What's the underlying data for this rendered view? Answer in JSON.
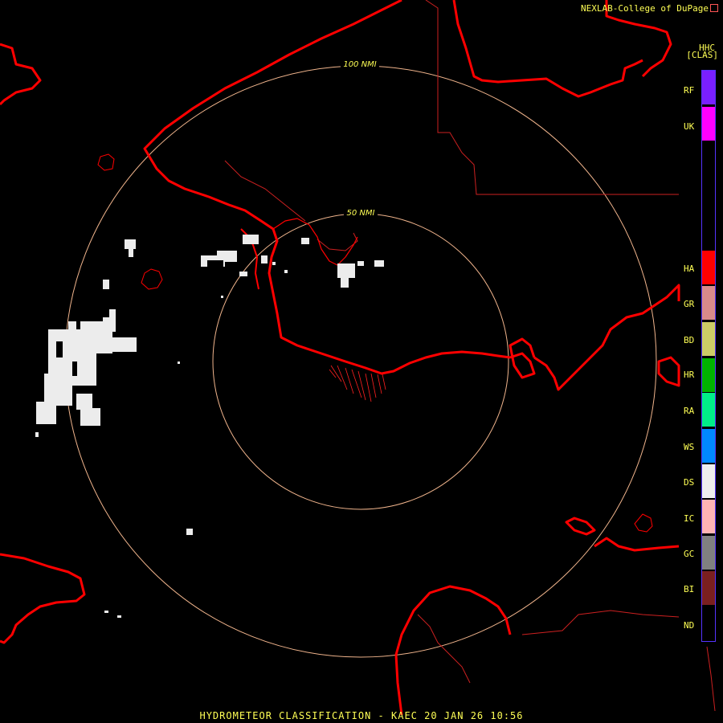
{
  "header": {
    "credit": "NEXLAB-College of DuPage",
    "product_code": "HHC",
    "scan_mode": "[CLAS]"
  },
  "rings": [
    {
      "label": "100 NMI"
    },
    {
      "label": "50 NMI"
    }
  ],
  "legend": [
    {
      "code": "RF",
      "color": "#7a1fff"
    },
    {
      "code": "UK",
      "color": "#ff00ff"
    },
    {
      "code": "HA",
      "color": "#ff0000"
    },
    {
      "code": "GR",
      "color": "#d98a8a"
    },
    {
      "code": "BD",
      "color": "#cccc66"
    },
    {
      "code": "HR",
      "color": "#00b400"
    },
    {
      "code": "RA",
      "color": "#00ee88"
    },
    {
      "code": "WS",
      "color": "#0088ff"
    },
    {
      "code": "DS",
      "color": "#eeeeee"
    },
    {
      "code": "IC",
      "color": "#ffb4b4"
    },
    {
      "code": "GC",
      "color": "#808080"
    },
    {
      "code": "BI",
      "color": "#7a1f1f"
    },
    {
      "code": "ND",
      "color": "#000000"
    }
  ],
  "colors": {
    "coastline": "#ff0000",
    "boundary": "#cc2020",
    "range_ring": "#f0b48c",
    "ring_label": "#ffff55",
    "echo": "#ececec"
  },
  "footer": "HYDROMETEOR CLASSIFICATION - KAEC 20 JAN 26 10:56"
}
